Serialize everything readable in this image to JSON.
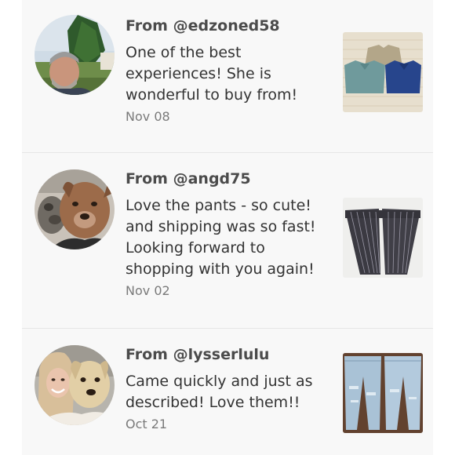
{
  "reviews": [
    {
      "from": "From @edzoned58",
      "body": "One of the best experiences! She is wonderful to buy from!",
      "date": "Nov 08"
    },
    {
      "from": "From @angd75",
      "body": "Love the pants - so cute! and shipping was so fast! Looking forward to shopping with you again!",
      "date": "Nov 02"
    },
    {
      "from": "From @lysserlulu",
      "body": "Came quickly and just as described! Love them!!",
      "date": "Oct 21"
    }
  ],
  "colors": {
    "page_background": "#f8f8f8",
    "username_text": "#4b4b4b",
    "body_text": "#333333",
    "date_text": "#7a7a7a",
    "divider": "#e6e6e6"
  }
}
